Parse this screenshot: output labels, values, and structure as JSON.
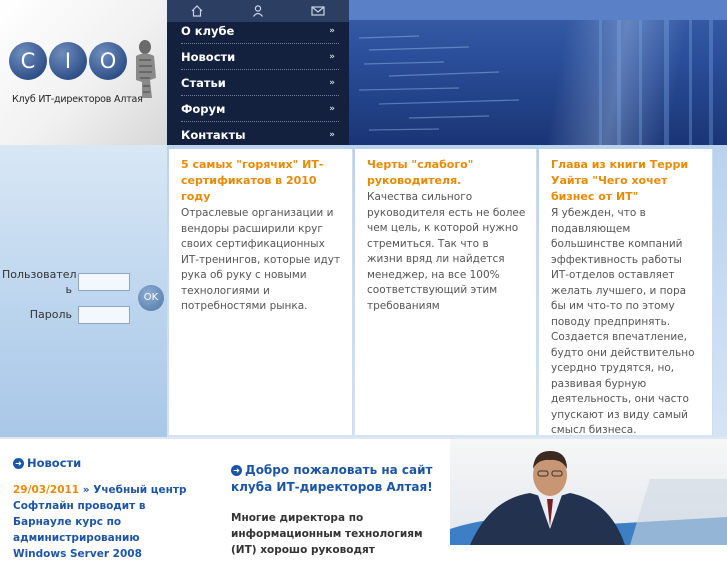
{
  "logo": {
    "letters": [
      "C",
      "I",
      "O"
    ],
    "caption": "Клуб ИТ-директоров Алтая"
  },
  "topbar": {
    "icons": [
      "home-icon",
      "user-icon",
      "mail-icon"
    ]
  },
  "nav": {
    "items": [
      {
        "label": "О клубе"
      },
      {
        "label": "Новости"
      },
      {
        "label": "Статьи"
      },
      {
        "label": "Форум"
      },
      {
        "label": "Контакты"
      }
    ],
    "chevron": "»"
  },
  "login": {
    "user_label_1": "Пользовател",
    "user_label_2": "ь",
    "password_label": "Пароль",
    "ok_label": "OK"
  },
  "teasers": [
    {
      "title": "5 самых \"горячих\" ИТ-сертификатов в 2010 году",
      "text": "Отраслевые организации и вендоры расширили круг своих сертификационных ИТ-тренингов, которые идут рука об руку с новыми технологиями и потребностями рынка."
    },
    {
      "title": "Черты \"слабого\" руководителя.",
      "text": "Качества сильного руководителя есть не более чем цель, к которой нужно стремиться. Так что в жизни вряд ли найдется менеджер, на все 100% соответствующий этим требованиям"
    },
    {
      "title": "Глава из книги Терри Уайта \"Чего хочет бизнес от ИТ\"",
      "text": "Я убежден, что в подавляющем большинстве компаний эффективность работы ИТ-отделов оставляет желать лучшего, и пора бы им что-то по этому поводу предпринять. Создается впечатление, будто они действительно усердно трудятся, но, развивая бурную деятельность, они часто упускают из виду самый смысл бизнеса."
    }
  ],
  "news": {
    "heading": "Новости",
    "date": "29/03/2011",
    "separator": " » ",
    "text": "Учебный центр Софтлайн проводит в Барнауле курс по администрированию Windows Server 2008"
  },
  "welcome": {
    "title": "Добро пожаловать на сайт клуба ИТ-директоров Алтая!",
    "text": "Многие директора по информационным технологиям (ИТ) хорошо руководят"
  },
  "colors": {
    "nav_bg": "#13213f",
    "accent_orange": "#e88a06",
    "link_blue": "#1d55a5"
  }
}
